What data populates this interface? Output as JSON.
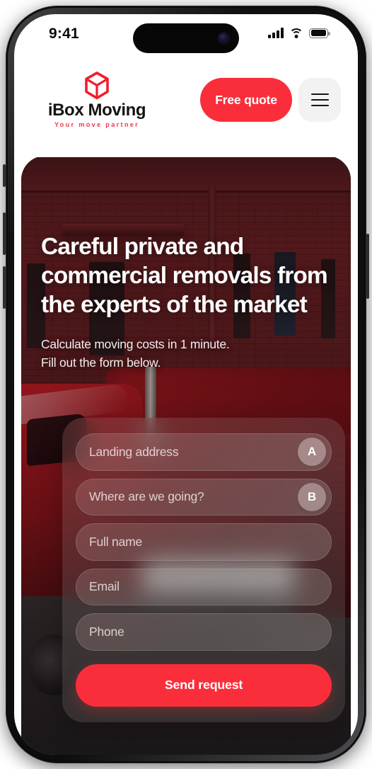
{
  "status_bar": {
    "time": "9:41",
    "signal_icon": "cellular-signal-icon",
    "wifi_icon": "wifi-icon",
    "battery_icon": "battery-full-icon"
  },
  "header": {
    "logo": {
      "icon": "cube-box-icon",
      "name": "iBox Moving",
      "tagline": "Your move partner",
      "accent_color": "#F4374A"
    },
    "quote_button": "Free quote",
    "menu_button_icon": "hamburger-menu-icon"
  },
  "hero": {
    "title": "Careful private and commercial removals from the experts of the market",
    "subtitle_line1": "Calculate moving costs in 1 minute.",
    "subtitle_line2": "Fill out the form below.",
    "background": "red-moving-truck-brick-building-photo"
  },
  "form": {
    "fields": [
      {
        "placeholder": "Landing address",
        "badge": "A",
        "name": "landing-address-input"
      },
      {
        "placeholder": "Where are we going?",
        "badge": "B",
        "name": "destination-input"
      },
      {
        "placeholder": "Full name",
        "badge": "",
        "name": "full-name-input"
      },
      {
        "placeholder": "Email",
        "badge": "",
        "name": "email-input"
      },
      {
        "placeholder": "Phone",
        "badge": "",
        "name": "phone-input"
      }
    ],
    "submit_label": "Send request"
  },
  "theme": {
    "brand_red": "#FA2E3B",
    "text_dark": "#141414",
    "surface_light": "#F2F2F2"
  }
}
